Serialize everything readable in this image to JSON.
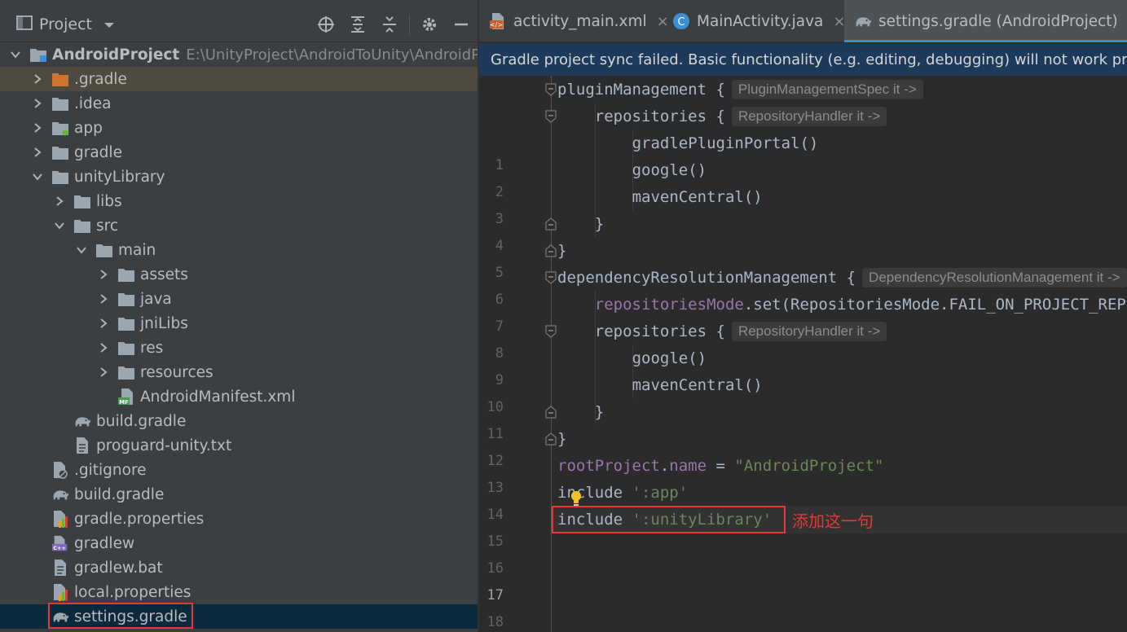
{
  "project_panel": {
    "title": "Project",
    "tree": [
      {
        "label": "AndroidProject",
        "path": "E:\\UnityProject\\AndroidToUnity\\AndroidProject",
        "icon": "module-folder-icon",
        "depth": 0,
        "expanded": true
      },
      {
        "label": ".gradle",
        "icon": "folder-orange-icon",
        "depth": 1,
        "expanded": false
      },
      {
        "label": ".idea",
        "icon": "folder-icon",
        "depth": 1,
        "expanded": false
      },
      {
        "label": "app",
        "icon": "app-module-icon",
        "depth": 1,
        "expanded": false
      },
      {
        "label": "gradle",
        "icon": "folder-icon",
        "depth": 1,
        "expanded": false
      },
      {
        "label": "unityLibrary",
        "icon": "folder-icon",
        "depth": 1,
        "expanded": true
      },
      {
        "label": "libs",
        "icon": "folder-icon",
        "depth": 2,
        "expanded": false
      },
      {
        "label": "src",
        "icon": "folder-icon",
        "depth": 2,
        "expanded": true
      },
      {
        "label": "main",
        "icon": "folder-icon",
        "depth": 3,
        "expanded": true
      },
      {
        "label": "assets",
        "icon": "folder-icon",
        "depth": 4,
        "expanded": false
      },
      {
        "label": "java",
        "icon": "folder-icon",
        "depth": 4,
        "expanded": false
      },
      {
        "label": "jniLibs",
        "icon": "folder-icon",
        "depth": 4,
        "expanded": false
      },
      {
        "label": "res",
        "icon": "folder-icon",
        "depth": 4,
        "expanded": false
      },
      {
        "label": "resources",
        "icon": "folder-icon",
        "depth": 4,
        "expanded": false
      },
      {
        "label": "AndroidManifest.xml",
        "icon": "manifest-file-icon",
        "depth": 4
      },
      {
        "label": "build.gradle",
        "icon": "gradle-elephant-icon",
        "depth": 2
      },
      {
        "label": "proguard-unity.txt",
        "icon": "text-file-icon",
        "depth": 2
      },
      {
        "label": ".gitignore",
        "icon": "gitignore-file-icon",
        "depth": 1
      },
      {
        "label": "build.gradle",
        "icon": "gradle-elephant-icon",
        "depth": 1
      },
      {
        "label": "gradle.properties",
        "icon": "properties-file-icon",
        "depth": 1
      },
      {
        "label": "gradlew",
        "icon": "cpp-script-file-icon",
        "depth": 1
      },
      {
        "label": "gradlew.bat",
        "icon": "text-file-icon",
        "depth": 1
      },
      {
        "label": "local.properties",
        "icon": "properties-file-icon",
        "depth": 1
      },
      {
        "label": "settings.gradle",
        "icon": "gradle-elephant-icon",
        "depth": 1,
        "selected": true
      }
    ]
  },
  "editor": {
    "tabs": [
      {
        "label": "activity_main.xml",
        "icon": "xml-file-icon",
        "active": false
      },
      {
        "label": "MainActivity.java",
        "icon": "java-class-icon",
        "active": false
      },
      {
        "label": "settings.gradle (AndroidProject)",
        "icon": "gradle-elephant-icon",
        "active": true
      }
    ],
    "sync_banner": "Gradle project sync failed. Basic functionality (e.g. editing, debugging) will not work properly.",
    "current_line": 17,
    "lines": [
      {
        "n": "1",
        "tokens": [
          {
            "t": "pluginManagement {",
            "c": "plain"
          }
        ],
        "hint": "PluginManagementSpec it ->"
      },
      {
        "n": "2",
        "indent": 1,
        "tokens": [
          {
            "t": "repositories {",
            "c": "plain"
          }
        ],
        "hint": "RepositoryHandler it ->"
      },
      {
        "n": "3",
        "indent": 2,
        "tokens": [
          {
            "t": "gradlePluginPortal()",
            "c": "plain"
          }
        ]
      },
      {
        "n": "4",
        "indent": 2,
        "tokens": [
          {
            "t": "google()",
            "c": "plain"
          }
        ]
      },
      {
        "n": "5",
        "indent": 2,
        "tokens": [
          {
            "t": "mavenCentral()",
            "c": "plain"
          }
        ]
      },
      {
        "n": "6",
        "indent": 1,
        "tokens": [
          {
            "t": "}",
            "c": "plain"
          }
        ]
      },
      {
        "n": "7",
        "tokens": [
          {
            "t": "}",
            "c": "plain"
          }
        ]
      },
      {
        "n": "8",
        "tokens": [
          {
            "t": "dependencyResolutionManagement {",
            "c": "plain"
          }
        ],
        "hint": "DependencyResolutionManagement it ->"
      },
      {
        "n": "9",
        "indent": 1,
        "tokens": [
          {
            "t": "repositoriesMode",
            "c": "prop"
          },
          {
            "t": ".set(RepositoriesMode.FAIL_ON_PROJECT_REPOS)",
            "c": "plain"
          }
        ]
      },
      {
        "n": "10",
        "indent": 1,
        "tokens": [
          {
            "t": "repositories {",
            "c": "plain"
          }
        ],
        "hint": "RepositoryHandler it ->"
      },
      {
        "n": "11",
        "indent": 2,
        "tokens": [
          {
            "t": "google()",
            "c": "plain"
          }
        ]
      },
      {
        "n": "12",
        "indent": 2,
        "tokens": [
          {
            "t": "mavenCentral()",
            "c": "plain"
          }
        ]
      },
      {
        "n": "13",
        "indent": 1,
        "tokens": [
          {
            "t": "}",
            "c": "plain"
          }
        ]
      },
      {
        "n": "14",
        "tokens": [
          {
            "t": "}",
            "c": "plain"
          }
        ]
      },
      {
        "n": "15",
        "tokens": [
          {
            "t": "rootProject",
            "c": "prop"
          },
          {
            "t": ".",
            "c": "plain"
          },
          {
            "t": "name",
            "c": "prop"
          },
          {
            "t": " = ",
            "c": "plain"
          },
          {
            "t": "\"AndroidProject\"",
            "c": "str"
          }
        ]
      },
      {
        "n": "16",
        "tokens": [
          {
            "t": "include ",
            "c": "plain"
          },
          {
            "t": "':app'",
            "c": "str"
          }
        ]
      },
      {
        "n": "17",
        "tokens": [
          {
            "t": "include ",
            "c": "plain"
          },
          {
            "t": "':unityLibrary'",
            "c": "str"
          }
        ]
      },
      {
        "n": "18",
        "tokens": []
      }
    ],
    "annotation": "添加这一句"
  },
  "colors": {
    "panel_bg": "#3c3f41",
    "editor_bg": "#2b2b2b",
    "selection": "#0d293e",
    "highlight_row": "#4e4a40",
    "accent_red": "#e53935",
    "string": "#6a8759",
    "property": "#9876aa"
  }
}
